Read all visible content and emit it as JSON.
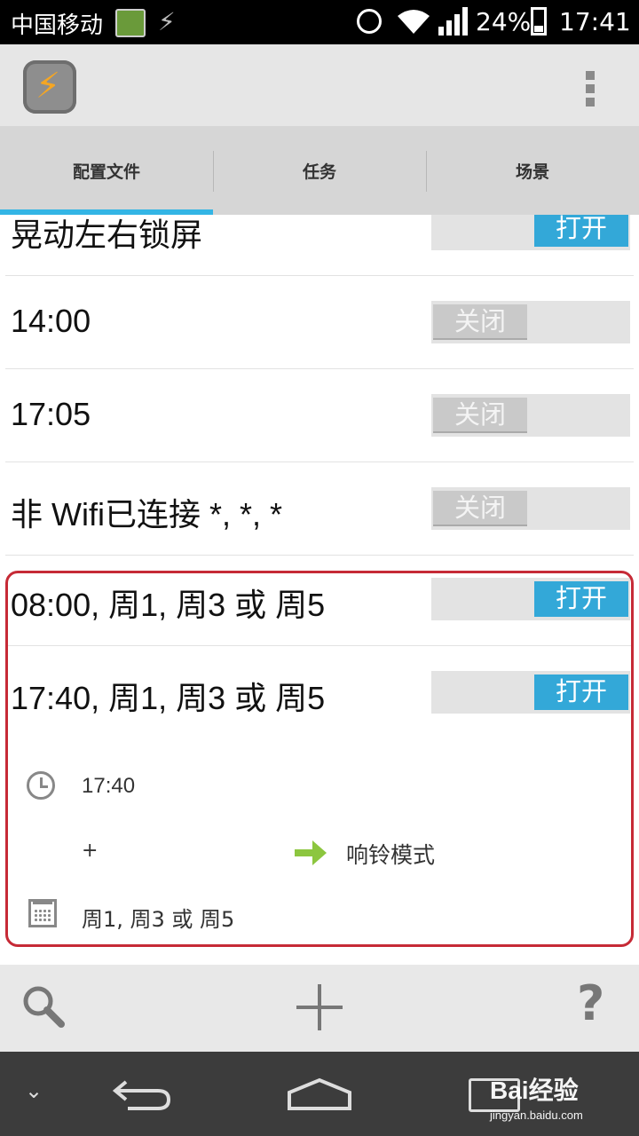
{
  "status_bar": {
    "carrier": "中国移动",
    "battery": "24%",
    "time": "17:41"
  },
  "tabs": [
    {
      "label": "配置文件",
      "active": true
    },
    {
      "label": "任务",
      "active": false
    },
    {
      "label": "场景",
      "active": false
    }
  ],
  "profiles": [
    {
      "name": "晃动左右锁屏",
      "state": "打开",
      "enabled": true
    },
    {
      "name": "14:00",
      "state": "关闭",
      "enabled": false
    },
    {
      "name": "17:05",
      "state": "关闭",
      "enabled": false
    },
    {
      "name": "非 Wifi已连接 *, *, *",
      "state": "关闭",
      "enabled": false
    },
    {
      "name": "08:00, 周1, 周3 或 周5",
      "state": "打开",
      "enabled": true
    },
    {
      "name": "17:40, 周1, 周3 或 周5",
      "state": "打开",
      "enabled": true
    }
  ],
  "expanded_profile": {
    "time_context": "17:40",
    "plus": "+",
    "task": "响铃模式",
    "day_context": "周1, 周3 或 周5"
  },
  "colors": {
    "accent": "#33b5e5",
    "toggle_on": "#33a8d8",
    "highlight_border": "#c62a36"
  },
  "watermark": {
    "brand": "Bai经验",
    "url": "jingyan.baidu.com"
  }
}
